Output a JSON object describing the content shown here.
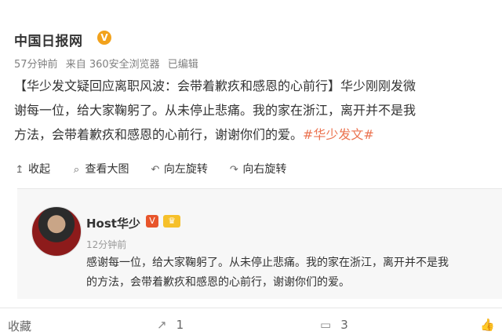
{
  "post": {
    "author": "中国日报网",
    "verified_icon": "V",
    "time": "57分钟前",
    "source": "来自 360安全浏览器",
    "edited": "已编辑",
    "text": [
      "【华少发文疑回应离职风波：会带着歉疚和感恩的心前行】华少刚刚发微",
      "谢每一位，给大家鞠躬了。从未停止悲痛。我的家在浙江，离开并不是我",
      "方法，会带着歉疚和感恩的心前行，谢谢你们的爱。"
    ],
    "hashtag": "#华少发文#"
  },
  "toolbar": [
    {
      "icon": "collapse-icon",
      "glyph": "↥",
      "label": "收起"
    },
    {
      "icon": "search-icon",
      "glyph": "⌕",
      "label": "查看大图"
    },
    {
      "icon": "rotate-left-icon",
      "glyph": "↶",
      "label": "向左旋转"
    },
    {
      "icon": "rotate-right-icon",
      "glyph": "↷",
      "label": "向右旋转"
    }
  ],
  "repost": {
    "name": "Host华少",
    "v_badge": "V",
    "badge": "♛",
    "time": "12分钟前",
    "text": [
      "感谢每一位，给大家鞠躬了。从未停止悲痛。我的家在浙江，离开并不是我",
      "的方法，会带着歉疚和感恩的心前行，谢谢你们的爱。"
    ]
  },
  "bottom": {
    "favorite": "收藏",
    "share_icon": "↗",
    "share_count": "1",
    "comment_icon": "▭",
    "comment_count": "3",
    "like_icon": "👍"
  },
  "colors": {
    "link": "#eb7350",
    "verified": "#f2a21c",
    "meta": "#808080"
  }
}
